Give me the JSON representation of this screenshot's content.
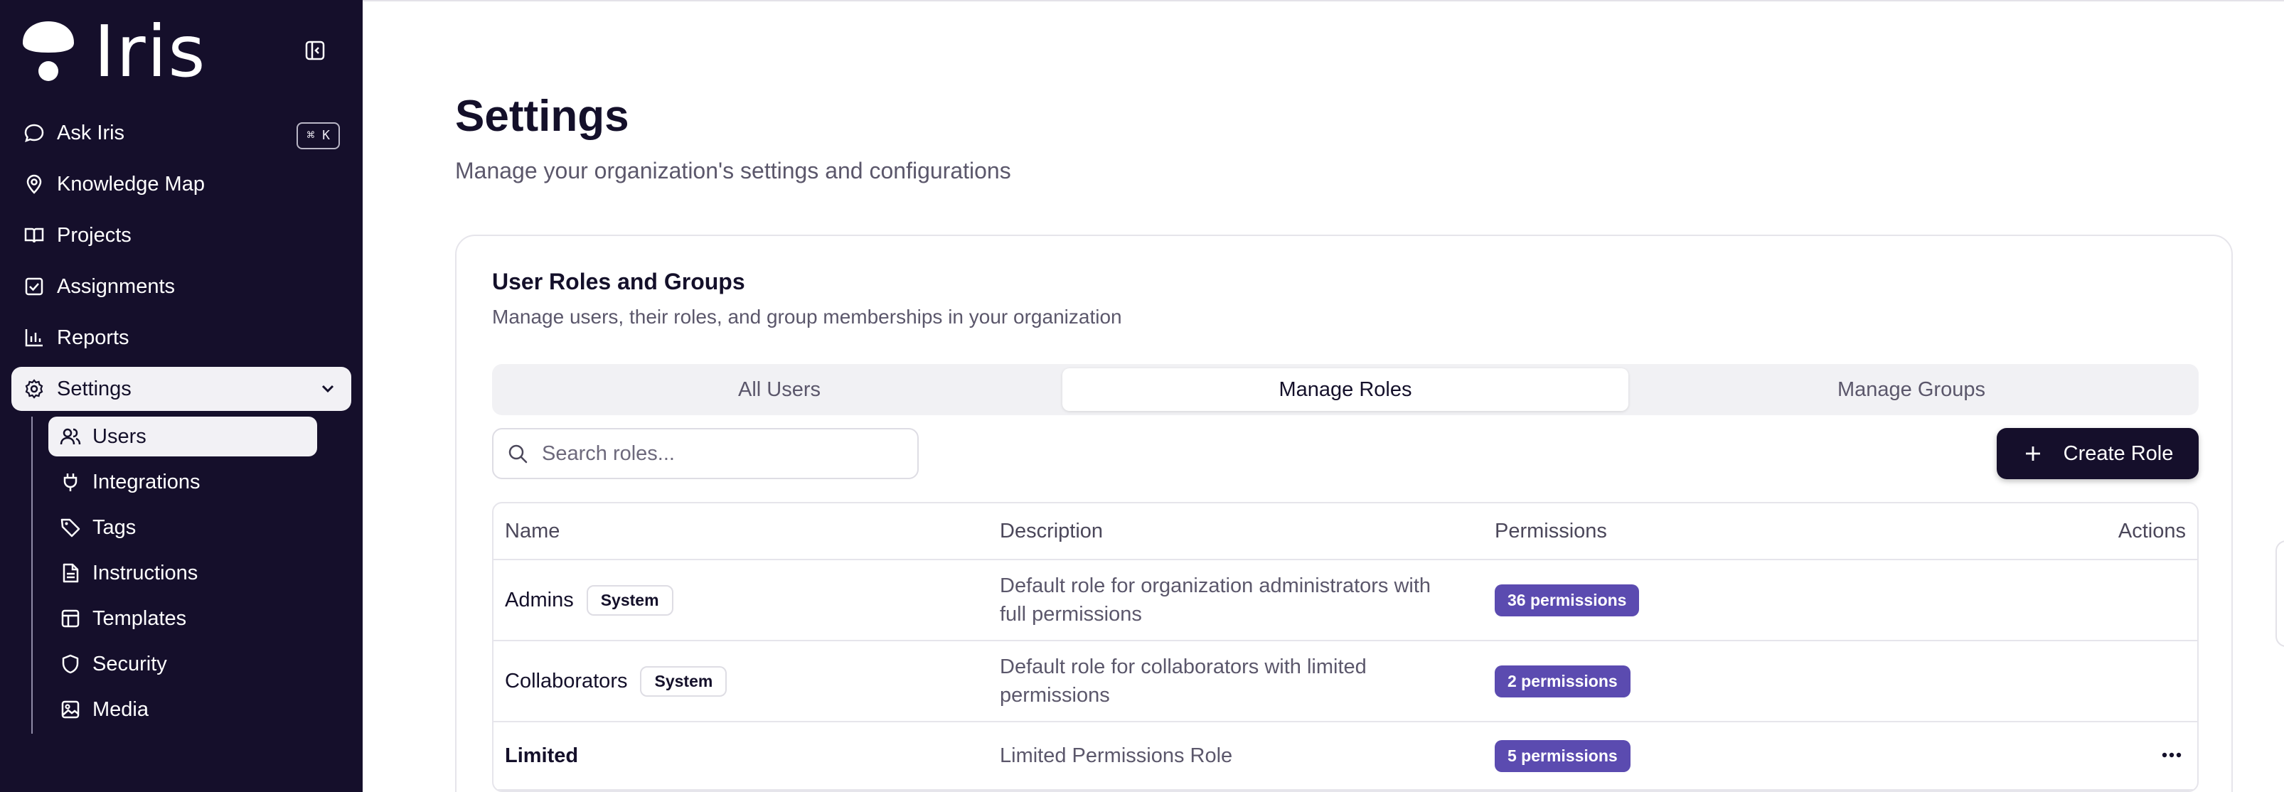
{
  "app": {
    "logo_text": "Iris"
  },
  "nav": {
    "items": [
      {
        "label": "Ask Iris",
        "shortcut": "⌘ K"
      },
      {
        "label": "Knowledge Map"
      },
      {
        "label": "Projects"
      },
      {
        "label": "Assignments"
      },
      {
        "label": "Reports"
      },
      {
        "label": "Settings"
      }
    ],
    "settings_sub": [
      {
        "label": "Users"
      },
      {
        "label": "Integrations"
      },
      {
        "label": "Tags"
      },
      {
        "label": "Instructions"
      },
      {
        "label": "Templates"
      },
      {
        "label": "Security"
      },
      {
        "label": "Media"
      }
    ]
  },
  "page": {
    "title": "Settings",
    "subtitle": "Manage your organization's settings and configurations"
  },
  "card": {
    "title": "User Roles and Groups",
    "subtitle": "Manage users, their roles, and group memberships in your organization",
    "tabs": [
      {
        "label": "All Users"
      },
      {
        "label": "Manage Roles"
      },
      {
        "label": "Manage Groups"
      }
    ],
    "search": {
      "placeholder": "Search roles...",
      "value": ""
    },
    "create_label": "Create Role",
    "table": {
      "headers": {
        "name": "Name",
        "description": "Description",
        "permissions": "Permissions",
        "actions": "Actions"
      },
      "rows": [
        {
          "name": "Admins",
          "badge": "System",
          "description": "Default role for organization administrators with full permissions",
          "permissions": "36 permissions"
        },
        {
          "name": "Collaborators",
          "badge": "System",
          "description": "Default role for collaborators with limited permissions",
          "permissions": "2 permissions"
        },
        {
          "name": "Limited",
          "description": "Limited Permissions Role",
          "permissions": "5 permissions"
        }
      ]
    }
  },
  "colors": {
    "sidebar_bg": "#150f2b",
    "accent_badge": "#5b4bb0",
    "primary_button": "#150f2b"
  }
}
